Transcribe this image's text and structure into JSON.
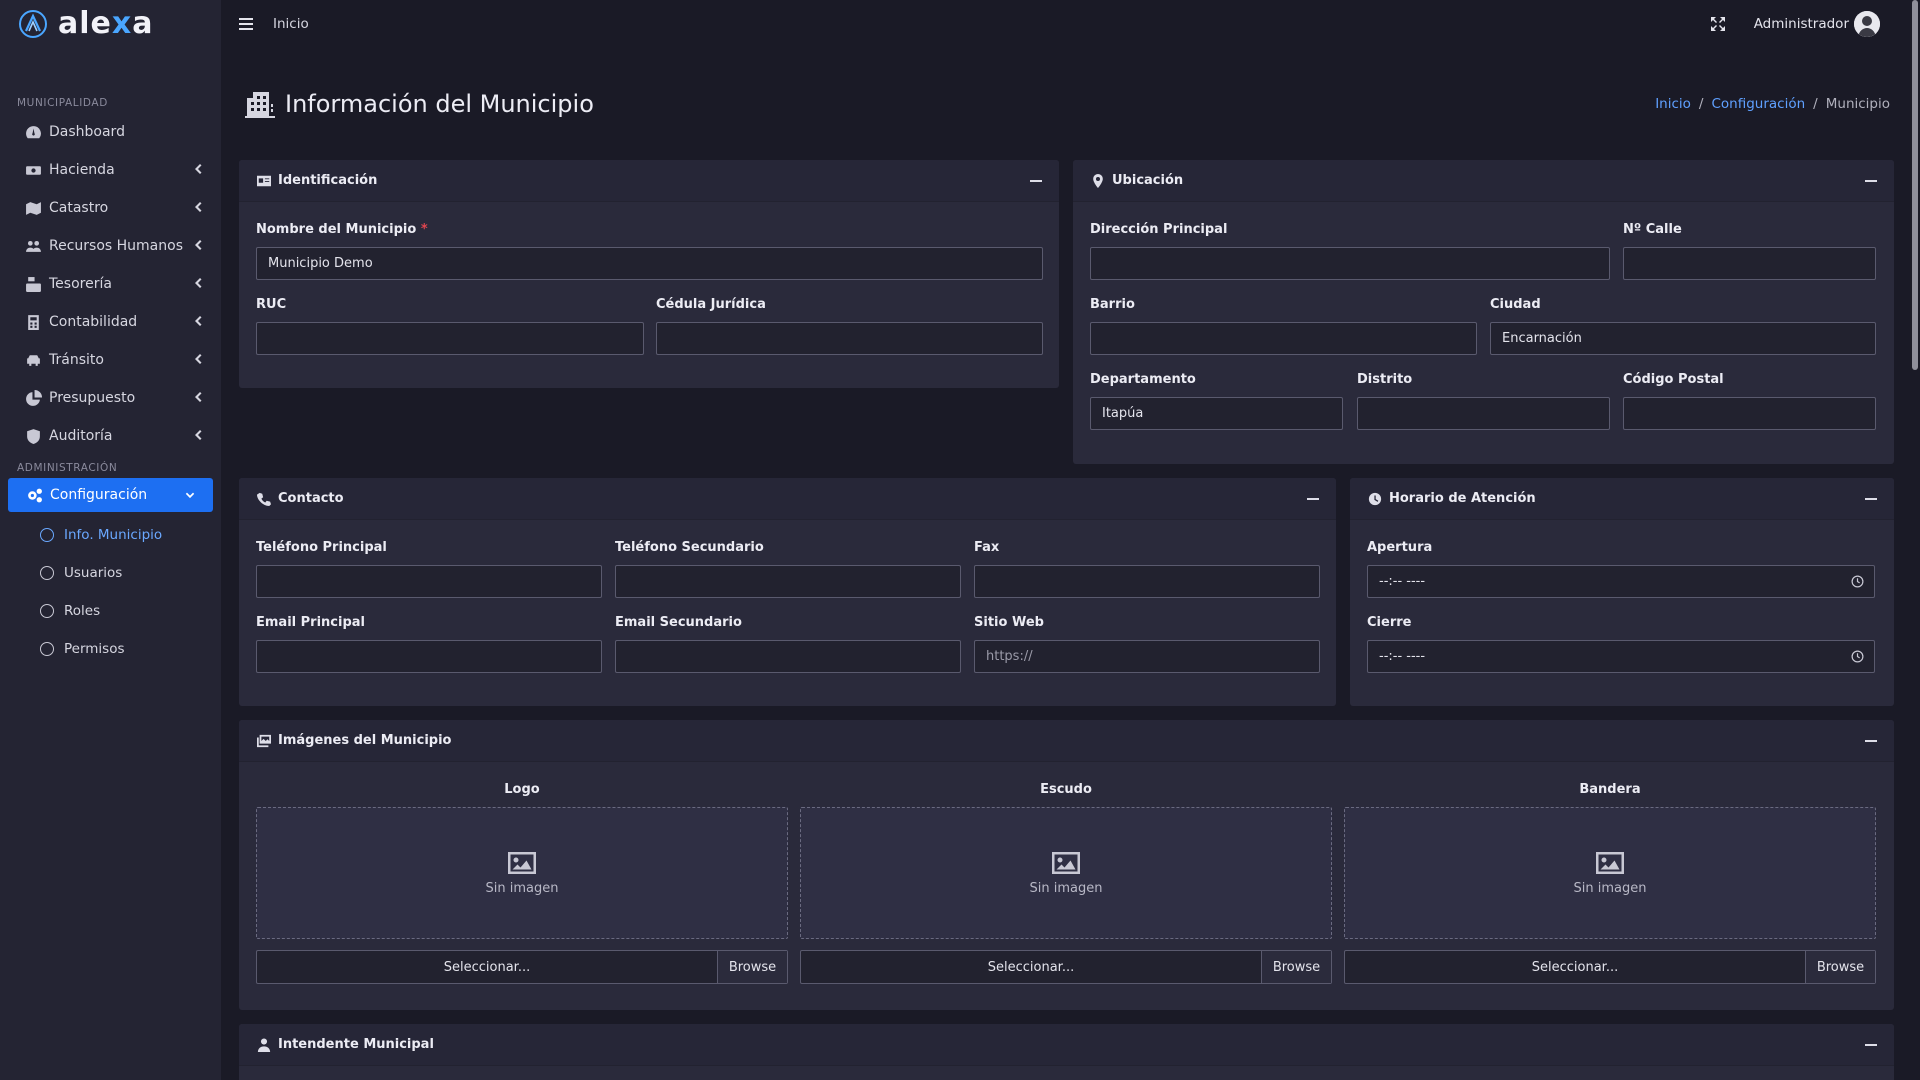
{
  "brand": {
    "name_prefix": "ale",
    "name_x": "x",
    "name_suffix": "a"
  },
  "topbar": {
    "home_link": "Inicio",
    "user_name": "Administrador"
  },
  "sidebar": {
    "section1": "MUNICIPALIDAD",
    "section2": "ADMINISTRACIÓN",
    "items": [
      {
        "label": "Dashboard",
        "icon": "tachometer-icon"
      },
      {
        "label": "Hacienda",
        "icon": "money-icon"
      },
      {
        "label": "Catastro",
        "icon": "map-icon"
      },
      {
        "label": "Recursos Humanos",
        "icon": "users-icon"
      },
      {
        "label": "Tesorería",
        "icon": "cash-register-icon"
      },
      {
        "label": "Contabilidad",
        "icon": "calculator-icon"
      },
      {
        "label": "Tránsito",
        "icon": "car-icon"
      },
      {
        "label": "Presupuesto",
        "icon": "pie-chart-icon"
      },
      {
        "label": "Auditoría",
        "icon": "shield-icon"
      }
    ],
    "config": {
      "label": "Configuración"
    },
    "sub_items": [
      {
        "label": "Info. Municipio"
      },
      {
        "label": "Usuarios"
      },
      {
        "label": "Roles"
      },
      {
        "label": "Permisos"
      }
    ]
  },
  "page": {
    "title": "Información del Municipio",
    "breadcrumb": [
      "Inicio",
      "Configuración",
      "Municipio"
    ]
  },
  "identificacion": {
    "header": "Identificación",
    "nombre_label": "Nombre del Municipio",
    "required_mark": "*",
    "nombre_value": "Municipio Demo",
    "ruc_label": "RUC",
    "cedula_label": "Cédula Jurídica"
  },
  "ubicacion": {
    "header": "Ubicación",
    "direccion_label": "Dirección Principal",
    "calle_label": "Nº Calle",
    "barrio_label": "Barrio",
    "ciudad_label": "Ciudad",
    "ciudad_value": "Encarnación",
    "departamento_label": "Departamento",
    "departamento_value": "Itapúa",
    "distrito_label": "Distrito",
    "postal_label": "Código Postal"
  },
  "contacto": {
    "header": "Contacto",
    "tel1_label": "Teléfono Principal",
    "tel2_label": "Teléfono Secundario",
    "fax_label": "Fax",
    "email1_label": "Email Principal",
    "email2_label": "Email Secundario",
    "web_label": "Sitio Web",
    "web_placeholder": "https://"
  },
  "horario": {
    "header": "Horario de Atención",
    "apertura_label": "Apertura",
    "apertura_value": "--:-- ----",
    "cierre_label": "Cierre",
    "cierre_value": "--:-- ----"
  },
  "imagenes": {
    "header": "Imágenes del Municipio",
    "slots": [
      {
        "title": "Logo",
        "empty": "Sin imagen",
        "select": "Seleccionar...",
        "browse": "Browse"
      },
      {
        "title": "Escudo",
        "empty": "Sin imagen",
        "select": "Seleccionar...",
        "browse": "Browse"
      },
      {
        "title": "Bandera",
        "empty": "Sin imagen",
        "select": "Seleccionar...",
        "browse": "Browse"
      }
    ]
  },
  "intendente": {
    "header": "Intendente Municipal"
  }
}
